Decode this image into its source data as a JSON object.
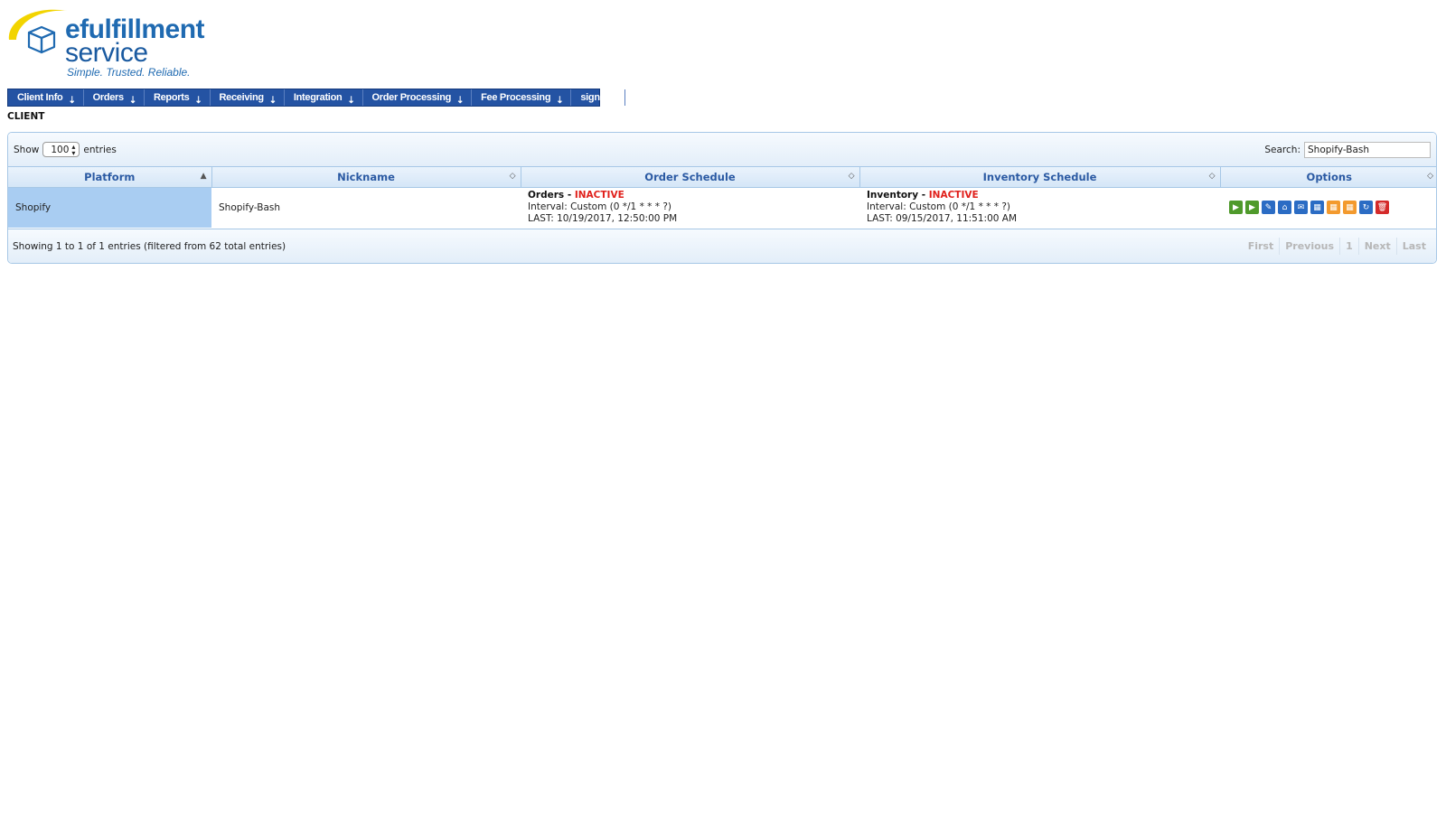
{
  "logo": {
    "brand_line1": "efulfillment",
    "brand_line2": "service",
    "tagline": "Simple. Trusted. Reliable.",
    "icon": "box-swoosh-logo"
  },
  "nav": {
    "items": [
      {
        "label": "Client Info"
      },
      {
        "label": "Orders"
      },
      {
        "label": "Reports"
      },
      {
        "label": "Receiving"
      },
      {
        "label": "Integration"
      },
      {
        "label": "Order Processing"
      },
      {
        "label": "Fee Processing"
      },
      {
        "label": "sign out"
      }
    ],
    "dropdown_arrow": "⇣"
  },
  "page_heading": "CLIENT",
  "toolbar": {
    "show_label": "Show",
    "entries_value": "100",
    "entries_label": "entries",
    "search_label": "Search:",
    "search_value": "Shopify-Bash"
  },
  "table": {
    "columns": [
      "Platform",
      "Nickname",
      "Order Schedule",
      "Inventory Schedule",
      "Options"
    ],
    "sort_icons": [
      "▲",
      "◇",
      "◇",
      "◇",
      "◇"
    ],
    "rows": [
      {
        "platform": "Shopify",
        "nickname": "Shopify-Bash",
        "order": {
          "title": "Orders",
          "sep": " - ",
          "status": "INACTIVE",
          "interval": "Interval: Custom (0 */1 * * * ?)",
          "last": "LAST: 10/19/2017, 12:50:00 PM"
        },
        "inventory": {
          "title": "Inventory",
          "sep": " - ",
          "status": "INACTIVE",
          "interval": "Interval: Custom (0 */1 * * * ?)",
          "last": "LAST: 09/15/2017, 11:51:00 AM"
        }
      }
    ],
    "option_icons": [
      {
        "name": "play-icon",
        "glyph": "▶",
        "color": "#4f9a2b"
      },
      {
        "name": "play-icon",
        "glyph": "▶",
        "color": "#4f9a2b"
      },
      {
        "name": "edit-icon",
        "glyph": "✎",
        "color": "#2b6cc4"
      },
      {
        "name": "lock-icon",
        "glyph": "⌂",
        "color": "#2b6cc4"
      },
      {
        "name": "mail-icon",
        "glyph": "✉",
        "color": "#2b6cc4"
      },
      {
        "name": "calendar-icon",
        "glyph": "▦",
        "color": "#2b6cc4"
      },
      {
        "name": "calendar-icon",
        "glyph": "▦",
        "color": "#f39a2e"
      },
      {
        "name": "calendar-icon",
        "glyph": "▦",
        "color": "#f39a2e"
      },
      {
        "name": "refresh-icon",
        "glyph": "↻",
        "color": "#2b6cc4"
      },
      {
        "name": "trash-icon",
        "glyph": "🗑",
        "color": "#d42a2a"
      }
    ]
  },
  "footer": {
    "info": "Showing 1 to 1 of 1 entries (filtered from 62 total entries)",
    "pager": [
      "First",
      "Previous",
      "1",
      "Next",
      "Last"
    ]
  },
  "colors": {
    "nav_bg": "#2453a3",
    "header_text": "#2b5aa3",
    "selected_cell": "#a9cdf2",
    "inactive": "#e0201b"
  }
}
